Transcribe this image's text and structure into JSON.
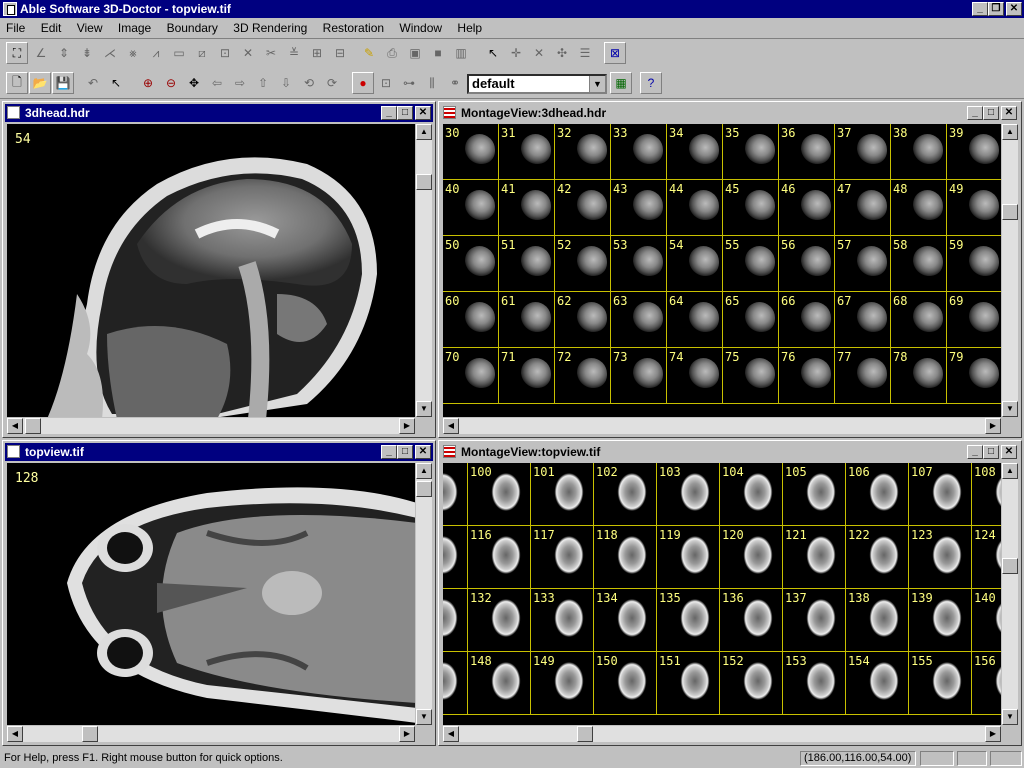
{
  "app": {
    "title": "Able Software 3D-Doctor - topview.tif"
  },
  "menu": [
    "File",
    "Edit",
    "View",
    "Image",
    "Boundary",
    "3D Rendering",
    "Restoration",
    "Window",
    "Help"
  ],
  "toolbar": {
    "combo_value": "default"
  },
  "windows": {
    "sagittal": {
      "title": "3dhead.hdr",
      "slice": "54"
    },
    "montage1": {
      "title": "MontageView:3dhead.hdr",
      "rows": [
        [
          "30",
          "31",
          "32",
          "33",
          "34",
          "35",
          "36",
          "37",
          "38",
          "39"
        ],
        [
          "40",
          "41",
          "42",
          "43",
          "44",
          "45",
          "46",
          "47",
          "48",
          "49"
        ],
        [
          "50",
          "51",
          "52",
          "53",
          "54",
          "55",
          "56",
          "57",
          "58",
          "59"
        ],
        [
          "60",
          "61",
          "62",
          "63",
          "64",
          "65",
          "66",
          "67",
          "68",
          "69"
        ],
        [
          "70",
          "71",
          "72",
          "73",
          "74",
          "75",
          "76",
          "77",
          "78",
          "79"
        ]
      ]
    },
    "axial": {
      "title": "topview.tif",
      "slice": "128"
    },
    "montage2": {
      "title": "MontageView:topview.tif",
      "rows": [
        [
          "",
          "100",
          "101",
          "102",
          "103",
          "104",
          "105",
          "106",
          "107",
          "108"
        ],
        [
          "",
          "116",
          "117",
          "118",
          "119",
          "120",
          "121",
          "122",
          "123",
          "124"
        ],
        [
          "",
          "132",
          "133",
          "134",
          "135",
          "136",
          "137",
          "138",
          "139",
          "140"
        ],
        [
          "",
          "148",
          "149",
          "150",
          "151",
          "152",
          "153",
          "154",
          "155",
          "156"
        ]
      ]
    }
  },
  "status": {
    "message": "For Help, press F1. Right mouse button for quick options.",
    "coords": "(186.00,116.00,54.00)"
  }
}
